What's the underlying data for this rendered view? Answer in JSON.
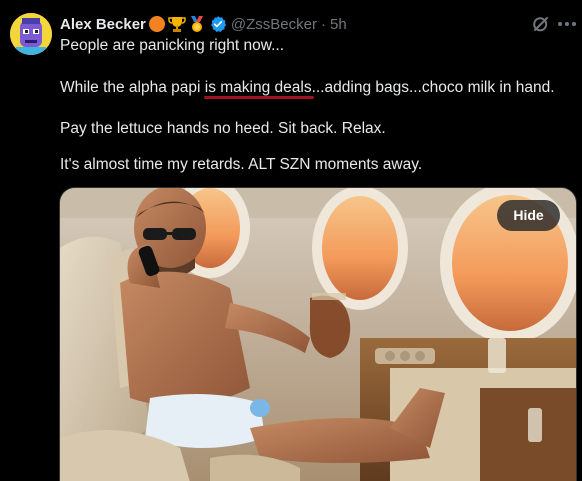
{
  "author": {
    "display_name": "Alex Becker",
    "handle": "@ZssBecker",
    "separator": "·",
    "time": "5h",
    "badges": [
      "orange-circle-icon",
      "trophy-icon",
      "medal-icon",
      "verified-badge-icon"
    ]
  },
  "tweet": {
    "line1": "People are panicking right now...",
    "line2_before": "While the alpha papi ",
    "line2_highlight": "is making deals",
    "line2_after": "...adding bags...choco milk in hand.",
    "line3": "Pay the lettuce hands no heed. Sit back. Relax.",
    "line4": "It's almost time my retards. ALT SZN moments away."
  },
  "media": {
    "hide_label": "Hide",
    "image_subject": "man-on-private-jet-image"
  },
  "actions": {
    "grok_icon": "grok-icon",
    "more_icon": "more-icon"
  },
  "colors": {
    "background": "#000000",
    "text": "#e7e9ea",
    "muted": "#71767b",
    "verified": "#1d9bf0",
    "underline": "#a1111f"
  }
}
